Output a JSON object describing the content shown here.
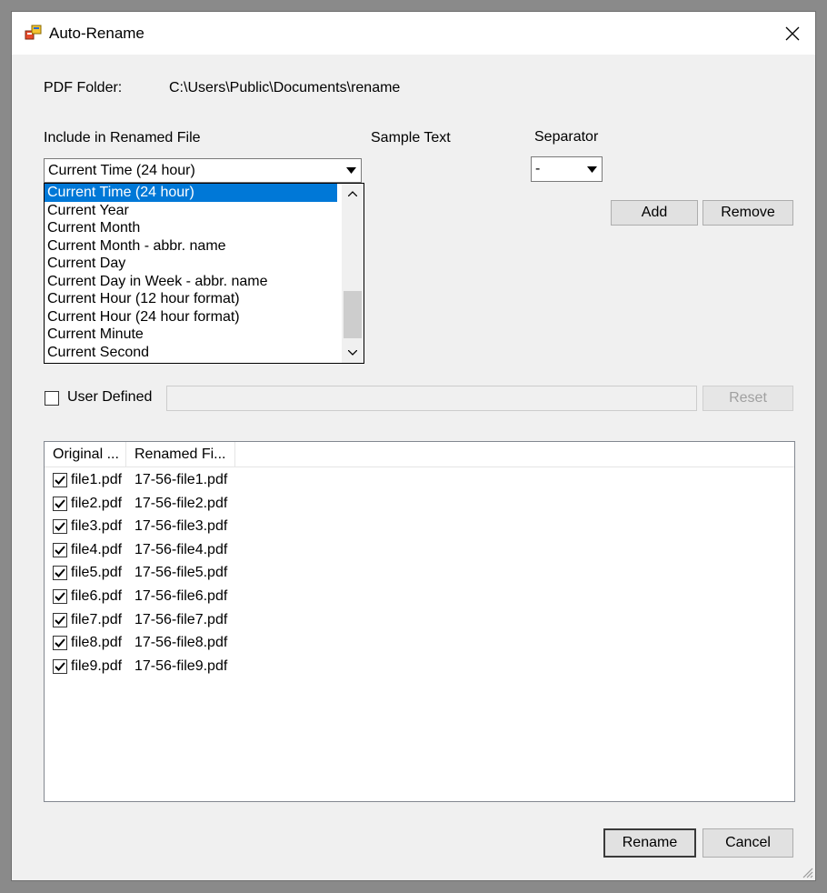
{
  "window": {
    "title": "Auto-Rename",
    "close_icon": "close-icon",
    "app_icon": "app-icon"
  },
  "folder": {
    "label": "PDF Folder:",
    "path": "C:\\Users\\Public\\Documents\\rename"
  },
  "include": {
    "label": "Include in Renamed File",
    "selected": "Current Time (24 hour)",
    "options": [
      "Current Time (24 hour)",
      "Current Year",
      "Current Month",
      "Current Month - abbr. name",
      "Current Day",
      "Current Day in Week - abbr. name",
      "Current Hour (12 hour format)",
      "Current Hour (24 hour format)",
      "Current Minute",
      "Current Second"
    ]
  },
  "sample_text": {
    "label": "Sample Text"
  },
  "separator": {
    "label": "Separator",
    "value": "-"
  },
  "buttons": {
    "add": "Add",
    "remove": "Remove",
    "reset": "Reset",
    "rename": "Rename",
    "cancel": "Cancel"
  },
  "user_defined": {
    "label": "User Defined",
    "checked": false,
    "value": ""
  },
  "files": {
    "columns": [
      "Original ...",
      "Renamed Fi..."
    ],
    "rows": [
      {
        "checked": true,
        "original": "file1.pdf",
        "renamed": "17-56-file1.pdf"
      },
      {
        "checked": true,
        "original": "file2.pdf",
        "renamed": "17-56-file2.pdf"
      },
      {
        "checked": true,
        "original": "file3.pdf",
        "renamed": "17-56-file3.pdf"
      },
      {
        "checked": true,
        "original": "file4.pdf",
        "renamed": "17-56-file4.pdf"
      },
      {
        "checked": true,
        "original": "file5.pdf",
        "renamed": "17-56-file5.pdf"
      },
      {
        "checked": true,
        "original": "file6.pdf",
        "renamed": "17-56-file6.pdf"
      },
      {
        "checked": true,
        "original": "file7.pdf",
        "renamed": "17-56-file7.pdf"
      },
      {
        "checked": true,
        "original": "file8.pdf",
        "renamed": "17-56-file8.pdf"
      },
      {
        "checked": true,
        "original": "file9.pdf",
        "renamed": "17-56-file9.pdf"
      }
    ]
  },
  "colors": {
    "selection": "#0078d7",
    "window_bg": "#f0f0f0"
  }
}
